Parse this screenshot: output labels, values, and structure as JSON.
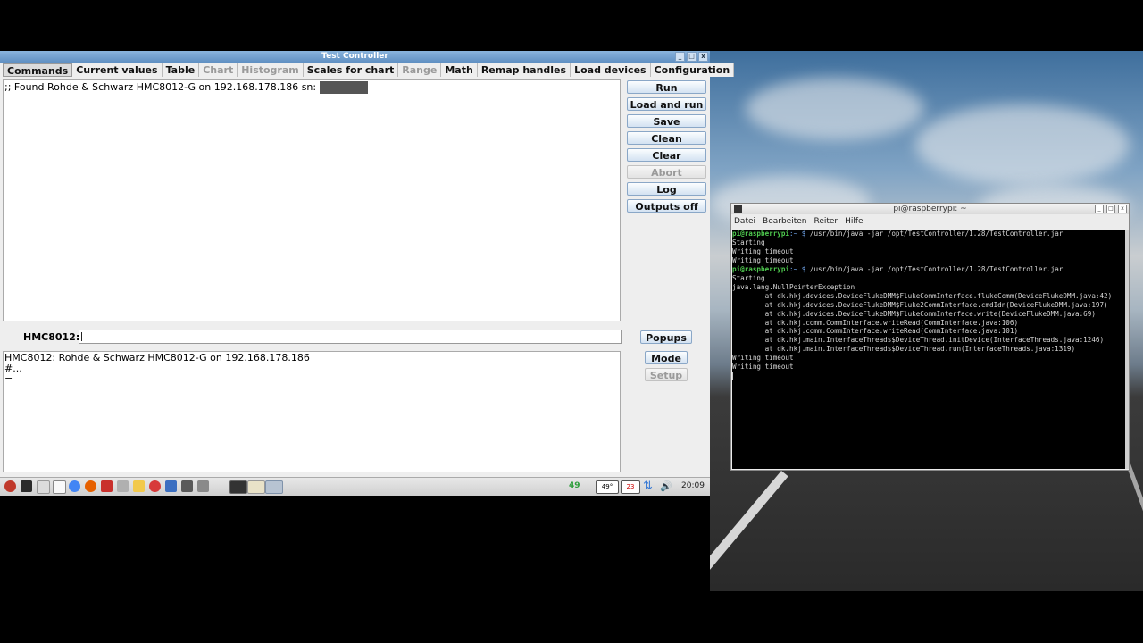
{
  "app": {
    "title": "Test Controller",
    "tabs": [
      {
        "label": "Commands",
        "state": "active"
      },
      {
        "label": "Current values",
        "state": "normal"
      },
      {
        "label": "Table",
        "state": "normal"
      },
      {
        "label": "Chart",
        "state": "disabled"
      },
      {
        "label": "Histogram",
        "state": "disabled"
      },
      {
        "label": "Scales for chart",
        "state": "normal"
      },
      {
        "label": "Range",
        "state": "disabled"
      },
      {
        "label": "Math",
        "state": "normal"
      },
      {
        "label": "Remap handles",
        "state": "normal"
      },
      {
        "label": "Load devices",
        "state": "normal"
      },
      {
        "label": "Configuration",
        "state": "normal"
      }
    ],
    "command_text": ";; Found Rohde & Schwarz HMC8012-G on 192.168.178.186 sn:",
    "buttons": {
      "run": "Run",
      "load_and_run": "Load and run",
      "save": "Save",
      "clean": "Clean",
      "clear": "Clear",
      "abort": "Abort",
      "log": "Log",
      "outputs_off": "Outputs off",
      "popups": "Popups",
      "mode": "Mode",
      "setup": "Setup"
    },
    "device_label": "HMC8012:",
    "device_input_value": "",
    "output_lines": [
      "HMC8012: Rohde & Schwarz HMC8012-G on 192.168.178.186",
      "#...",
      "="
    ]
  },
  "taskbar": {
    "counter": "49",
    "temp": "49°",
    "cpu": "23",
    "clock": "20:09"
  },
  "terminal": {
    "title": "pi@raspberrypi: ~",
    "menu": [
      "Datei",
      "Bearbeiten",
      "Reiter",
      "Hilfe"
    ],
    "prompt_user": "pi@raspberrypi",
    "prompt_path": ":~ $",
    "command": " /usr/bin/java -jar /opt/TestController/1.28/TestController.jar",
    "lines_block1": [
      "Starting",
      "Writing timeout",
      "Writing timeout"
    ],
    "lines_block2": [
      "Starting",
      "java.lang.NullPointerException",
      "        at dk.hkj.devices.DeviceFlukeDMM$FlukeCommInterface.flukeComm(DeviceFlukeDMM.java:42)",
      "        at dk.hkj.devices.DeviceFlukeDMM$Fluke2CommInterface.cmdIdn(DeviceFlukeDMM.java:197)",
      "        at dk.hkj.devices.DeviceFlukeDMM$FlukeCommInterface.write(DeviceFlukeDMM.java:69)",
      "        at dk.hkj.comm.CommInterface.writeRead(CommInterface.java:106)",
      "        at dk.hkj.comm.CommInterface.writeRead(CommInterface.java:101)",
      "        at dk.hkj.main.InterfaceThreads$DeviceThread.initDevice(InterfaceThreads.java:1246)",
      "        at dk.hkj.main.InterfaceThreads$DeviceThread.run(InterfaceThreads.java:1319)",
      "Writing timeout",
      "Writing timeout"
    ]
  }
}
